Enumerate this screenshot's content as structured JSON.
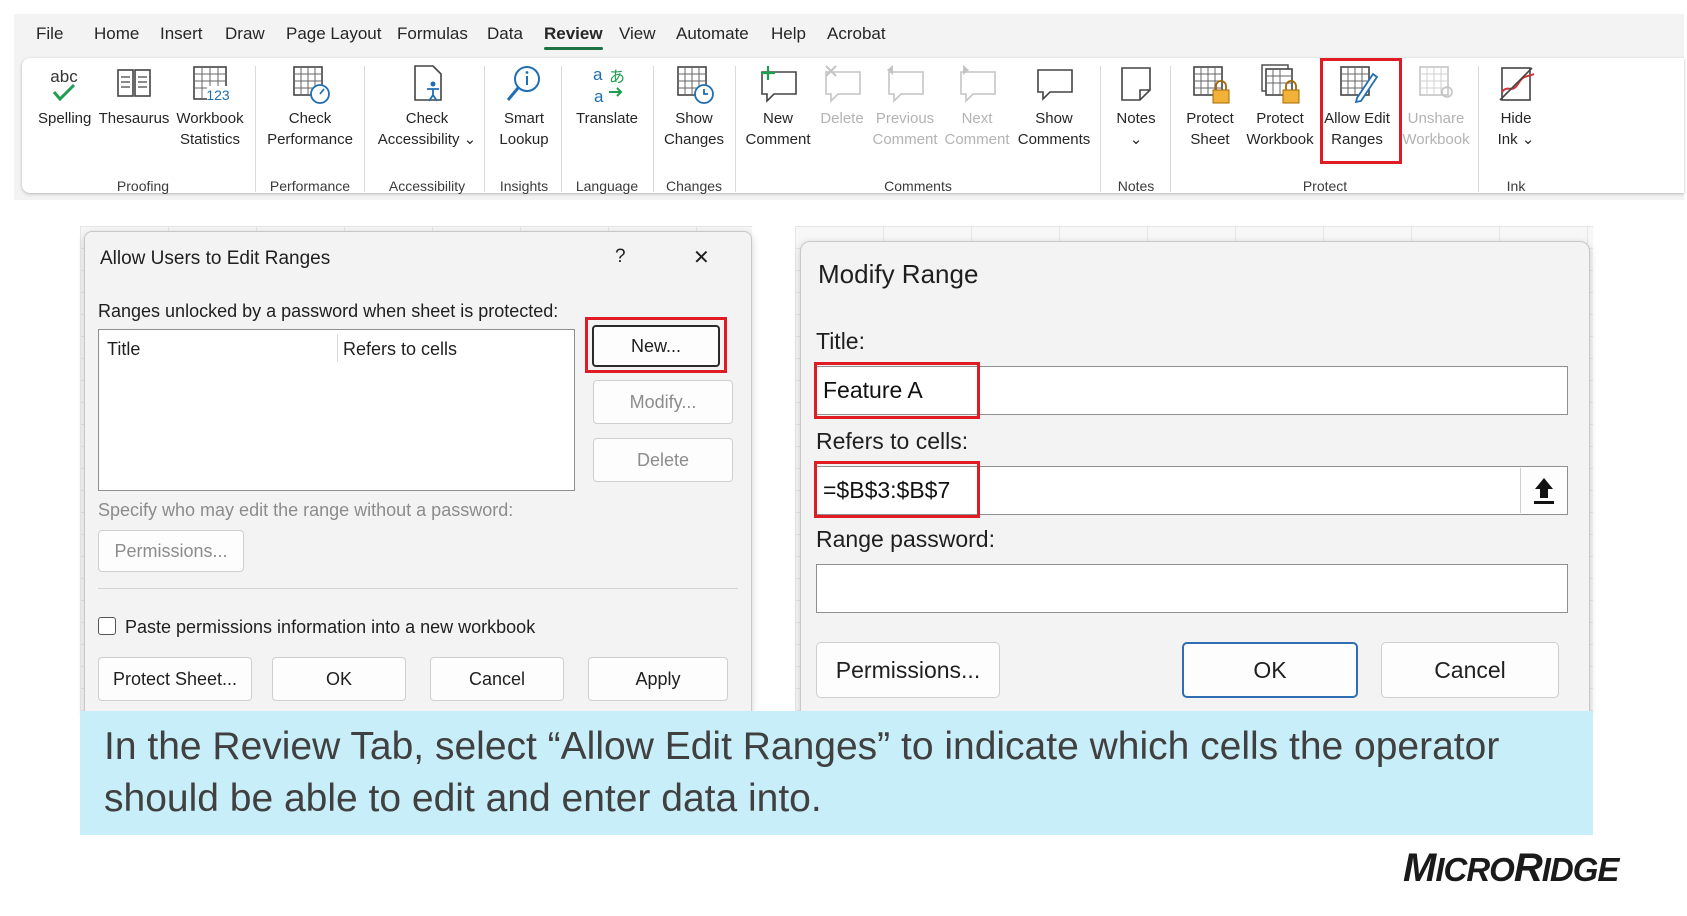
{
  "ribbon": {
    "tabs": [
      "File",
      "Home",
      "Insert",
      "Draw",
      "Page Layout",
      "Formulas",
      "Data",
      "Review",
      "View",
      "Automate",
      "Help",
      "Acrobat"
    ],
    "active_tab": "Review",
    "commands": {
      "spelling": [
        "Spelling"
      ],
      "thesaurus": [
        "Thesaurus"
      ],
      "workbook_statistics": [
        "Workbook",
        "Statistics"
      ],
      "check_performance": [
        "Check",
        "Performance"
      ],
      "check_accessibility": [
        "Check",
        "Accessibility ⌄"
      ],
      "smart_lookup": [
        "Smart",
        "Lookup"
      ],
      "translate": [
        "Translate"
      ],
      "show_changes": [
        "Show",
        "Changes"
      ],
      "new_comment": [
        "New",
        "Comment"
      ],
      "delete": [
        "Delete"
      ],
      "previous_comment": [
        "Previous",
        "Comment"
      ],
      "next_comment": [
        "Next",
        "Comment"
      ],
      "show_comments": [
        "Show",
        "Comments"
      ],
      "notes": [
        "Notes",
        "⌄"
      ],
      "protect_sheet": [
        "Protect",
        "Sheet"
      ],
      "protect_workbook": [
        "Protect",
        "Workbook"
      ],
      "allow_edit_ranges": [
        "Allow Edit",
        "Ranges"
      ],
      "unshare_workbook": [
        "Unshare",
        "Workbook"
      ],
      "hide_ink": [
        "Hide",
        "Ink ⌄"
      ]
    },
    "groups": {
      "proofing": "Proofing",
      "performance": "Performance",
      "accessibility": "Accessibility",
      "insights": "Insights",
      "language": "Language",
      "changes": "Changes",
      "comments": "Comments",
      "notes": "Notes",
      "protect": "Protect",
      "ink": "Ink"
    },
    "icon_texts": {
      "spelling": "abc",
      "workbook_statistics": "123"
    }
  },
  "allow_users_dialog": {
    "title": "Allow Users to Edit Ranges",
    "help": "?",
    "close": "✕",
    "ranges_label": "Ranges unlocked by a password when sheet is protected:",
    "list_headers": [
      "Title",
      "Refers to cells"
    ],
    "buttons": {
      "new": "New...",
      "modify": "Modify...",
      "delete": "Delete",
      "permissions": "Permissions...",
      "protect_sheet": "Protect Sheet...",
      "ok": "OK",
      "cancel": "Cancel",
      "apply": "Apply"
    },
    "specify_label": "Specify who may edit the range without a password:",
    "paste_checkbox": "Paste permissions information into a new workbook"
  },
  "modify_range_dialog": {
    "title": "Modify Range",
    "title_label": "Title:",
    "title_value": "Feature A",
    "refers_label": "Refers to cells:",
    "refers_value": "=$B$3:$B$7",
    "password_label": "Range password:",
    "password_value": "",
    "buttons": {
      "permissions": "Permissions...",
      "ok": "OK",
      "cancel": "Cancel"
    }
  },
  "caption": "In the Review Tab, select “Allow Edit Ranges” to indicate which cells the operator should be able to edit and enter data into.",
  "logo": {
    "big_m": "M",
    "icro": "ICRO",
    "big_r": "R",
    "idge": "IDGE"
  },
  "colors": {
    "highlight": "#e01b24",
    "caption_bg": "#c8eef9",
    "active_tab_underline": "#1e7145"
  }
}
